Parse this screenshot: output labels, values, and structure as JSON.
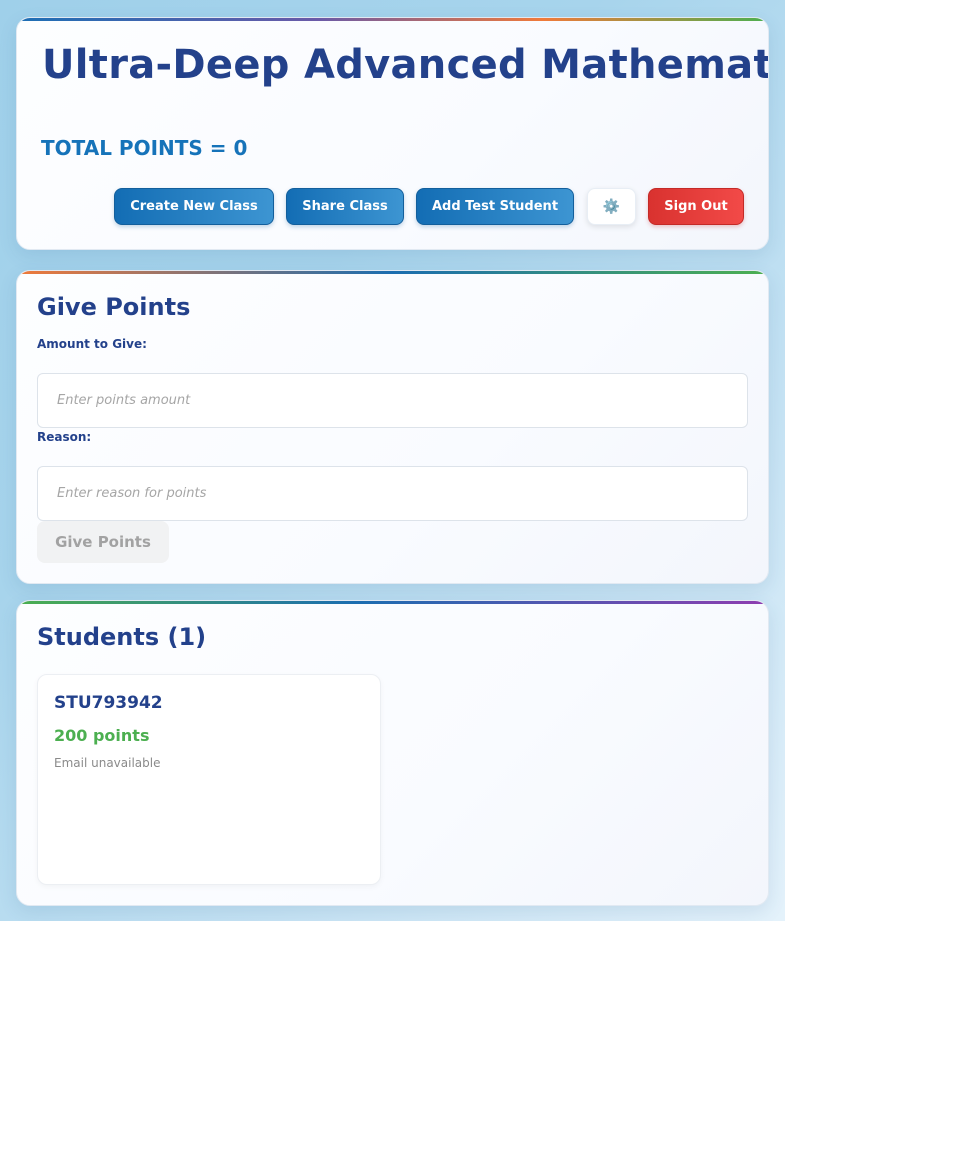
{
  "header": {
    "title": "Ultra-Deep Advanced Mathematics",
    "total_points": "TOTAL POINTS = 0",
    "buttons": {
      "create_class": "Create New Class",
      "share_class": "Share Class",
      "add_test_student": "Add Test Student",
      "settings_icon": "⚙️",
      "sign_out": "Sign Out"
    }
  },
  "give_points": {
    "title": "Give Points",
    "amount_label": "Amount to Give:",
    "amount_value": "",
    "amount_placeholder": "Enter points amount",
    "reason_label": "Reason:",
    "reason_value": "",
    "reason_placeholder": "Enter reason for points",
    "submit_label": "Give Points"
  },
  "students": {
    "title": "Students (1)",
    "items": [
      {
        "id": "STU793942",
        "points": "200 points",
        "email": "Email unavailable"
      }
    ]
  },
  "icons": {
    "settings": "gear-icon"
  },
  "colors": {
    "primary_blue": "#136db4",
    "title_navy": "#23418b",
    "danger_red": "#e03a37",
    "points_green": "#4caf50"
  }
}
